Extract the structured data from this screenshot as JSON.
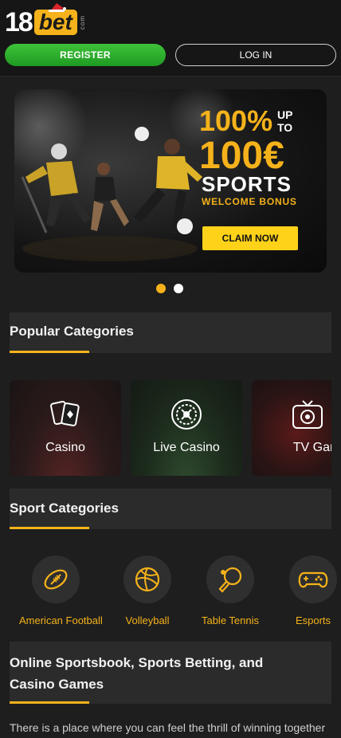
{
  "header": {
    "logo_number": "18",
    "logo_word": "bet",
    "logo_domain": "com",
    "register_label": "REGISTER",
    "login_label": "LOG IN"
  },
  "banner": {
    "percent": "100%",
    "up": "UP",
    "to": "TO",
    "amount": "100€",
    "sports": "SPORTS",
    "welcome": "WELCOME BONUS",
    "claim_label": "CLAIM NOW",
    "slide_count": 2,
    "active_slide": 1
  },
  "popular_categories": {
    "title": "Popular Categories",
    "items": [
      {
        "label": "Casino",
        "icon": "cards-icon"
      },
      {
        "label": "Live Casino",
        "icon": "roulette-icon"
      },
      {
        "label": "TV Games",
        "icon": "tv-icon"
      }
    ]
  },
  "sport_categories": {
    "title": "Sport Categories",
    "items": [
      {
        "label": "American Football",
        "icon": "american-football-icon"
      },
      {
        "label": "Volleyball",
        "icon": "volleyball-icon"
      },
      {
        "label": "Table Tennis",
        "icon": "table-tennis-icon"
      },
      {
        "label": "Esports",
        "icon": "gamepad-icon"
      }
    ]
  },
  "article": {
    "title_line1": "Online Sportsbook, Sports Betting, and",
    "title_line2": "Casino Games",
    "text": "There is a place where you can feel the thrill of winning together"
  },
  "colors": {
    "accent": "#f5b21a",
    "register_green": "#2fb02c",
    "background": "#1e1e1e",
    "section_bg": "#2b2b2b"
  }
}
